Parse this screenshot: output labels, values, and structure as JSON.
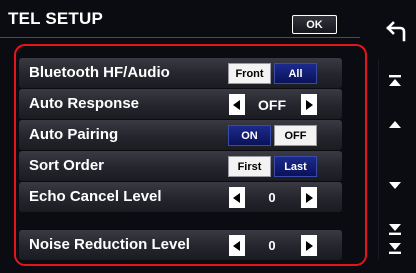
{
  "header": {
    "title": "TEL SETUP",
    "ok_label": "OK"
  },
  "settings": {
    "bluetooth": {
      "label": "Bluetooth HF/Audio",
      "options": [
        "Front",
        "All"
      ],
      "selected": "All"
    },
    "auto_response": {
      "label": "Auto Response",
      "value": "OFF"
    },
    "auto_pairing": {
      "label": "Auto Pairing",
      "options": [
        "ON",
        "OFF"
      ],
      "selected": "ON"
    },
    "sort_order": {
      "label": "Sort Order",
      "options": [
        "First",
        "Last"
      ],
      "selected": "Last"
    },
    "echo_cancel": {
      "label": "Echo Cancel Level",
      "value": "0"
    },
    "noise_reduction": {
      "label": "Noise Reduction Level",
      "value": "0"
    }
  },
  "icons": {
    "back": "back-arrow-icon",
    "scroll_top": "scroll-to-top-icon",
    "scroll_up": "scroll-up-icon",
    "scroll_down": "scroll-down-icon",
    "scroll_bottom": "scroll-to-bottom-icon"
  },
  "colors": {
    "highlight_frame": "#e8141b",
    "selected_button": "#0a1258",
    "unselected_button": "#f3f3f3"
  }
}
